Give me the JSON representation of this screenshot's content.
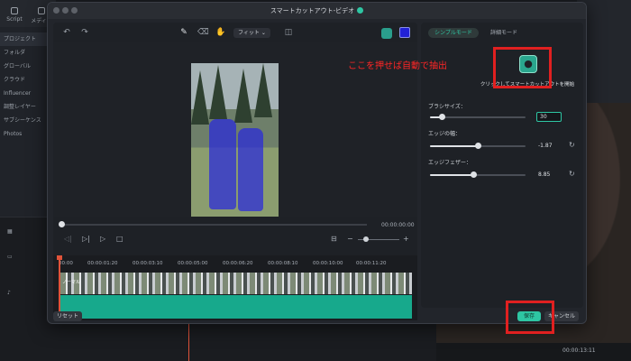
{
  "background": {
    "tabs": [
      {
        "label": "Script"
      },
      {
        "label": "メディア"
      }
    ],
    "sidebar_rows": [
      "プロジェクト",
      "フォルダ",
      "グローバル",
      "クラウド",
      "Influencer",
      "調整レイヤー",
      "サブシーケンス",
      "Photos"
    ],
    "playhead_time": "00:00:13:11"
  },
  "dialog": {
    "title": "スマートカットアウト-ビデオ",
    "toolbar": {
      "fit_label": "フィット",
      "fit_chevron_icon": "chevron-down-icon",
      "undo_icon": "undo-icon",
      "redo_icon": "redo-icon",
      "brush_icon": "brush-icon",
      "eraser_icon": "eraser-icon",
      "hand_icon": "hand-icon",
      "compare_icon": "compare-icon",
      "person_icon": "person-icon",
      "mask_color": "#2222d6"
    },
    "player": {
      "timecode": "00:00:00:00",
      "progress": 0,
      "zoom_minus": "−",
      "zoom_plus": "+"
    },
    "timeline": {
      "ruler": [
        "00:00",
        "00:00:01:20",
        "00:00:03:10",
        "00:00:05:00",
        "00:00:06:20",
        "00:00:08:10",
        "00:00:10:00",
        "00:00:11:20"
      ],
      "track_label": "ノーマル"
    },
    "reset_label": "リセット",
    "settings": {
      "tabs": [
        {
          "label": "シンプルモード",
          "active": true
        },
        {
          "label": "詳細モード",
          "active": false
        }
      ],
      "auto_cutout_label": "クリックしてスマートカットアウトを開始",
      "brush_size": {
        "label": "ブラシサイズ：",
        "value": "30",
        "level": 0.12
      },
      "edge_thickness": {
        "label": "エッジの幅：",
        "value": "-1.87",
        "level": 0.5
      },
      "edge_feather": {
        "label": "エッジフェザー：",
        "value": "8.85",
        "level": 0.45
      }
    },
    "save_label": "保存",
    "cancel_label": "キャンセル"
  },
  "annotation": {
    "note": "ここを押せば自動で抽出",
    "color": "#ff2626"
  }
}
